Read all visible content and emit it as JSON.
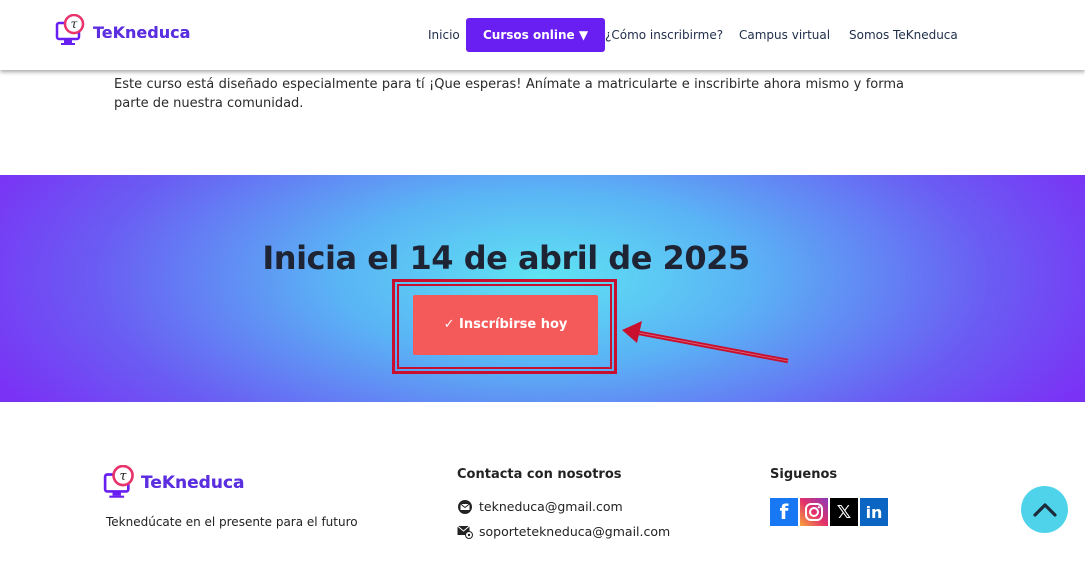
{
  "header": {
    "brand": "TeKneduca",
    "nav": [
      {
        "label": "Inicio"
      },
      {
        "label": "Cursos online ▼"
      },
      {
        "label": "¿Cómo inscribirme?"
      },
      {
        "label": "Campus virtual"
      },
      {
        "label": "Somos TeKneduca"
      }
    ]
  },
  "intro": {
    "text": "Este curso está diseñado especialmente para tí ¡Que esperas! Anímate a matricularte e inscribirte ahora mismo y forma parte de nuestra comunidad."
  },
  "banner": {
    "title": "Inicia el 14 de abril de 2025",
    "cta_label": "✓ Inscríbirse hoy"
  },
  "footer": {
    "brand": "TeKneduca",
    "tagline": "Teknedúcate en el presente para el futuro",
    "contact_heading": "Contacta con nosotros",
    "emails": [
      "tekneduca@gmail.com",
      "soportetekneduca@gmail.com"
    ],
    "social_heading": "Siguenos",
    "social": [
      {
        "icon": "facebook-icon",
        "glyph": "f",
        "color": "#1877f2"
      },
      {
        "icon": "instagram-icon",
        "glyph": "◎",
        "color": "#e1306c"
      },
      {
        "icon": "x-icon",
        "glyph": "X",
        "color": "#000000"
      },
      {
        "icon": "linkedin-icon",
        "glyph": "in",
        "color": "#0a66c2"
      }
    ]
  },
  "colors": {
    "accent": "#6a1ff2",
    "cta": "#f55a5a",
    "annotation": "#c8102e",
    "scroll_top": "#4fd3ea"
  }
}
